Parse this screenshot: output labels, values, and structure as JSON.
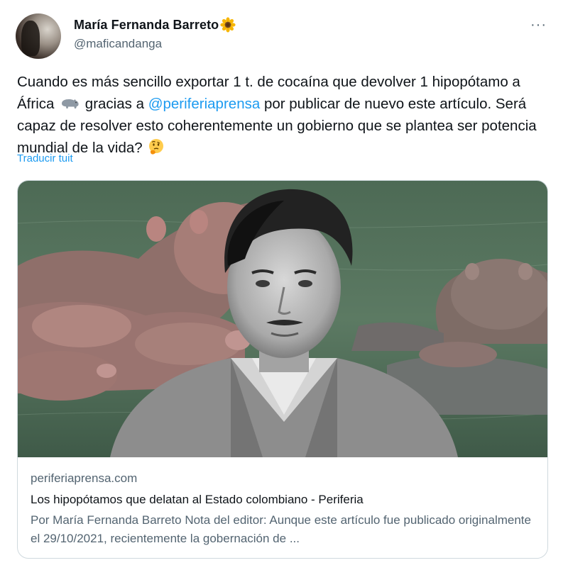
{
  "author": {
    "display_name": "María Fernanda Barreto",
    "handle": "@maficandanga",
    "name_emoji": "sunflower-icon"
  },
  "menu": {
    "more_label": "···"
  },
  "tweet": {
    "text_part1": "Cuando es más sencillo exportar 1 t. de cocaína que devolver 1 hipopótamo a África ",
    "text_part2": " gracias a ",
    "mention": "@periferiaprensa",
    "text_part3": " por publicar de nuevo este artículo. Será capaz de resolver esto coherentemente un gobierno que se plantea ser potencia mundial de la vida? ",
    "emoji_1": "hippo-icon",
    "emoji_2": "thinking-face-icon",
    "translate_label": "Traducir tuit"
  },
  "card": {
    "domain": "periferiaprensa.com",
    "title": "Los hipopótamos que delatan al Estado colombiano - Periferia",
    "description": "Por María Fernanda Barreto Nota del editor: Aunque este artículo fue publicado originalmente el 29/10/2021, recientemente la gobernación de ...",
    "image_subject": "hippos in river with black-and-white portrait"
  },
  "colors": {
    "accent": "#1d9bf0",
    "secondary_text": "#536471",
    "border": "#cfd9de"
  }
}
